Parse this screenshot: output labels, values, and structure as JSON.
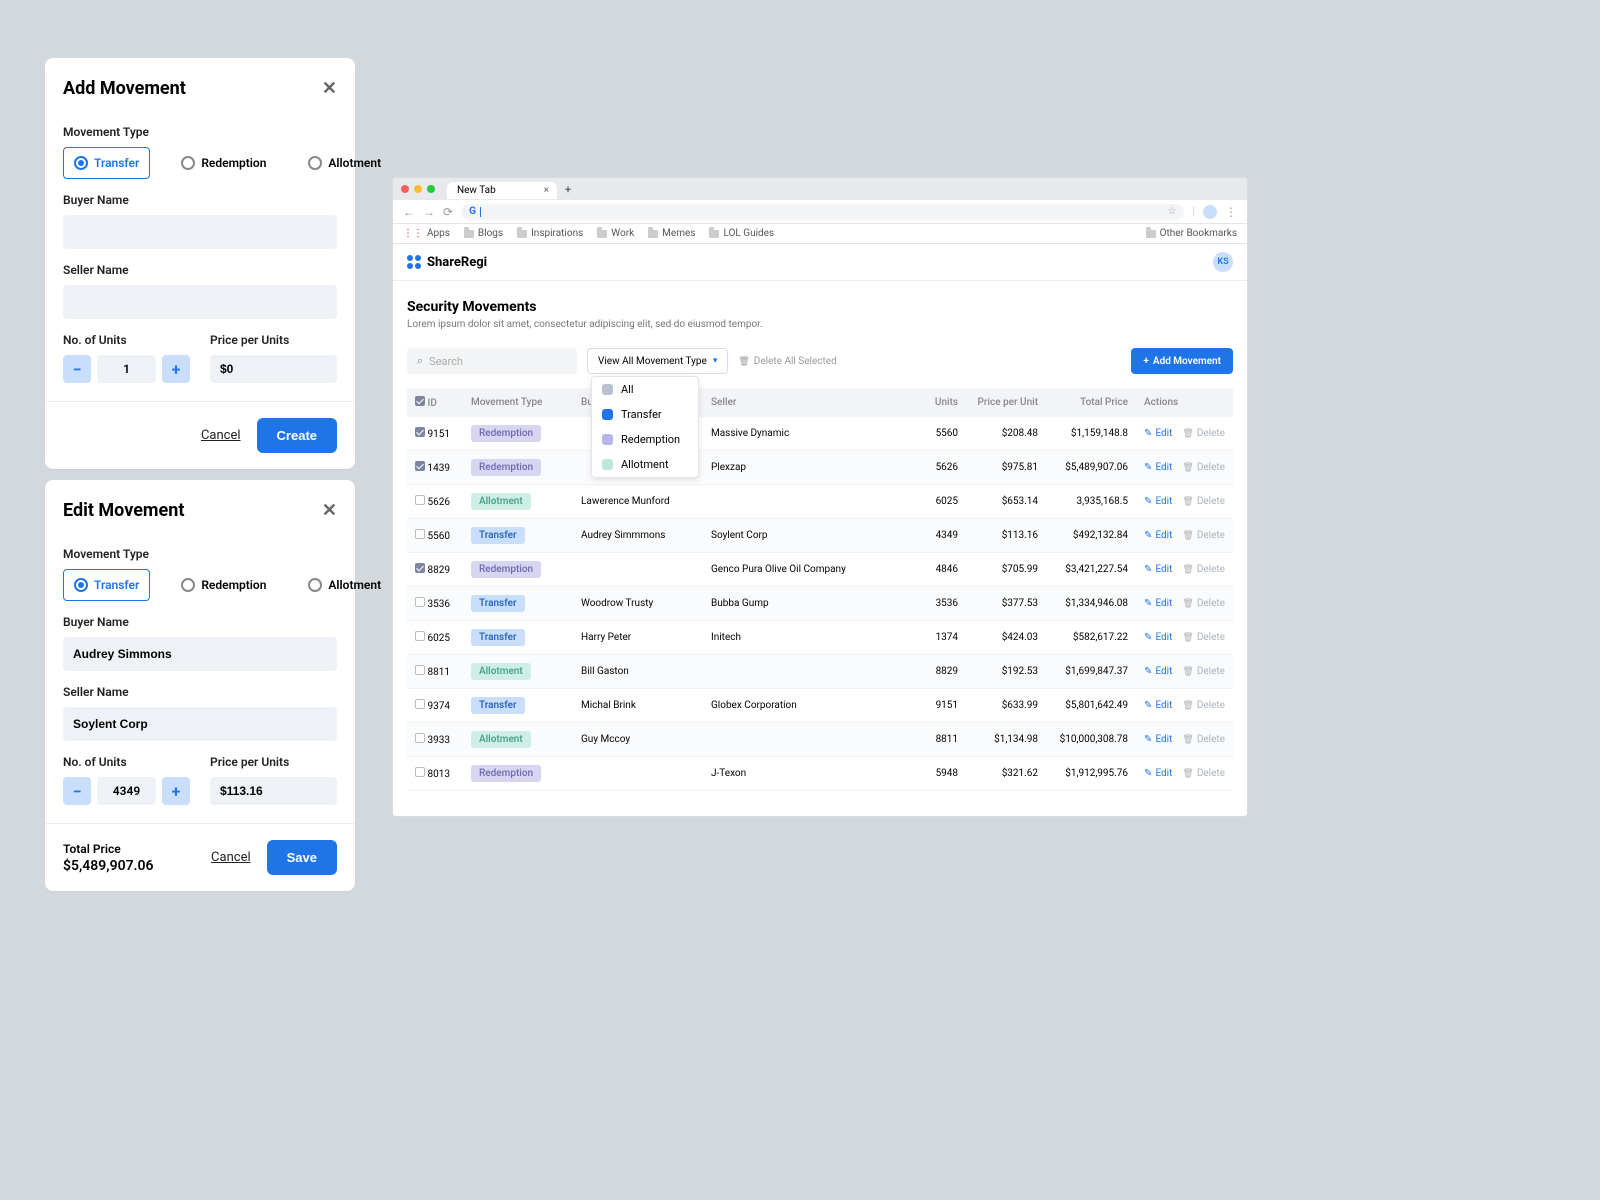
{
  "add_modal": {
    "title": "Add Movement",
    "movement_type_label": "Movement Type",
    "radios": {
      "transfer": "Transfer",
      "redemption": "Redemption",
      "allotment": "Allotment"
    },
    "buyer_label": "Buyer Name",
    "seller_label": "Seller Name",
    "units_label": "No. of Units",
    "units_value": "1",
    "price_label": "Price per Units",
    "price_value": "$0",
    "cancel": "Cancel",
    "submit": "Create"
  },
  "edit_modal": {
    "title": "Edit Movement",
    "movement_type_label": "Movement Type",
    "radios": {
      "transfer": "Transfer",
      "redemption": "Redemption",
      "allotment": "Allotment"
    },
    "buyer_label": "Buyer Name",
    "buyer_value": "Audrey Simmons",
    "seller_label": "Seller Name",
    "seller_value": "Soylent Corp",
    "units_label": "No. of Units",
    "units_value": "4349",
    "price_label": "Price per Units",
    "price_value": "$113.16",
    "total_label": "Total Price",
    "total_value": "$5,489,907.06",
    "cancel": "Cancel",
    "submit": "Save"
  },
  "browser": {
    "tab": "New Tab",
    "url_letter": "G",
    "bookmarks": [
      "Apps",
      "Blogs",
      "Inspirations",
      "Work",
      "Memes",
      "LOL Guides"
    ],
    "other_bookmarks": "Other Bookmarks"
  },
  "app": {
    "brand": "ShareRegi",
    "avatar": "KS",
    "page_title": "Security Movements",
    "page_sub": "Lorem ipsum dolor sit amet, consectetur adipiscing elit, sed do eiusmod tempor.",
    "search_placeholder": "Search",
    "filter_label": "View All Movement Type",
    "delete_all": "Delete All Selected",
    "add_btn": "Add Movement",
    "filter_options": {
      "all": "All",
      "transfer": "Transfer",
      "redemption": "Redemption",
      "allotment": "Allotment"
    },
    "columns": {
      "id": "ID",
      "type": "Movement Type",
      "buyer": "Buyer",
      "seller": "Seller",
      "units": "Units",
      "ppu": "Price per Unit",
      "total": "Total Price",
      "actions": "Actions"
    },
    "actions": {
      "edit": "Edit",
      "delete": "Delete"
    },
    "rows": [
      {
        "id": "9151",
        "type": "Redemption",
        "buyer": "",
        "seller": "Massive Dynamic",
        "units": "5560",
        "ppu": "$208.48",
        "total": "$1,159,148.8",
        "checked": true
      },
      {
        "id": "1439",
        "type": "Redemption",
        "buyer": "",
        "seller": "Plexzap",
        "units": "5626",
        "ppu": "$975.81",
        "total": "$5,489,907.06",
        "checked": true
      },
      {
        "id": "5626",
        "type": "Allotment",
        "buyer": "Lawerence Munford",
        "seller": "",
        "units": "6025",
        "ppu": "$653.14",
        "total": "3,935,168.5",
        "checked": false
      },
      {
        "id": "5560",
        "type": "Transfer",
        "buyer": "Audrey Simmmons",
        "seller": "Soylent Corp",
        "units": "4349",
        "ppu": "$113.16",
        "total": "$492,132.84",
        "checked": false
      },
      {
        "id": "8829",
        "type": "Redemption",
        "buyer": "",
        "seller": "Genco Pura Olive Oil Company",
        "units": "4846",
        "ppu": "$705.99",
        "total": "$3,421,227.54",
        "checked": true
      },
      {
        "id": "3536",
        "type": "Transfer",
        "buyer": "Woodrow Trusty",
        "seller": "Bubba Gump",
        "units": "3536",
        "ppu": "$377.53",
        "total": "$1,334,946.08",
        "checked": false
      },
      {
        "id": "6025",
        "type": "Transfer",
        "buyer": "Harry Peter",
        "seller": "Initech",
        "units": "1374",
        "ppu": "$424.03",
        "total": "$582,617.22",
        "checked": false
      },
      {
        "id": "8811",
        "type": "Allotment",
        "buyer": "Bill Gaston",
        "seller": "",
        "units": "8829",
        "ppu": "$192.53",
        "total": "$1,699,847.37",
        "checked": false
      },
      {
        "id": "9374",
        "type": "Transfer",
        "buyer": "Michal Brink",
        "seller": "Globex Corporation",
        "units": "9151",
        "ppu": "$633.99",
        "total": "$5,801,642.49",
        "checked": false
      },
      {
        "id": "3933",
        "type": "Allotment",
        "buyer": "Guy Mccoy",
        "seller": "",
        "units": "8811",
        "ppu": "$1,134.98",
        "total": "$10,000,308.78",
        "checked": false
      },
      {
        "id": "8013",
        "type": "Redemption",
        "buyer": "",
        "seller": "J-Texon",
        "units": "5948",
        "ppu": "$321.62",
        "total": "$1,912,995.76",
        "checked": false
      }
    ]
  }
}
